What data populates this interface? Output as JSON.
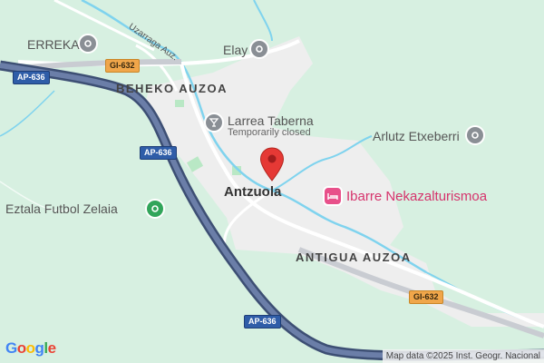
{
  "map": {
    "colors": {
      "land": "#d7f0e1",
      "urban": "#eeeeee",
      "highway": "#4a5d82",
      "river": "#7fd3ee",
      "marker": "#e53935",
      "poi_pink": "#e8508a",
      "poi_green": "#31a55a"
    },
    "areas": [
      "BEHEKO AUZOA",
      "ANTIGUA AUZOA"
    ],
    "streets": [
      "Uzarraga Auz."
    ],
    "places": {
      "town": "Antzuola",
      "erreka": "ERREKA",
      "elay": "Elay",
      "arlutz": "Arlutz Etxeberri",
      "eztala": "Eztala Futbol Zelaia",
      "ibarre": "Ibarre Nekazalturismoa",
      "larrea": "Larrea Taberna",
      "larrea_status": "Temporarily closed"
    },
    "shields": {
      "ap_top": "AP-636",
      "ap_mid": "AP-636",
      "ap_bottom": "AP-636",
      "gi_top": "GI-632",
      "gi_right": "GI-632"
    },
    "icons": [
      "location-pin-icon",
      "bar-icon",
      "hotel-icon",
      "park-icon",
      "place-icon"
    ],
    "logo": "Google",
    "attribution": "Map data ©2025 Inst. Geogr. Nacional"
  }
}
